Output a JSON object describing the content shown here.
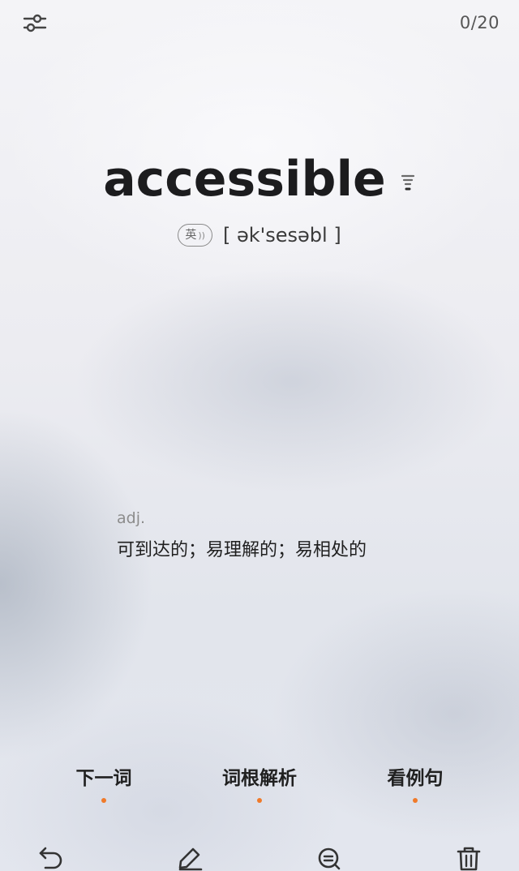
{
  "header": {
    "settings_icon": "sliders-icon",
    "progress": "0/20"
  },
  "word": {
    "headword": "accessible",
    "frequency_icon": "frequency-bars-icon",
    "accent_label": "英",
    "sound_icon": "sound-wave-icon",
    "phonetic": "[ ək'sesəbl ]"
  },
  "definition": {
    "part_of_speech": "adj.",
    "meaning": "可到达的；易理解的；易相处的"
  },
  "actions": {
    "next_word": "下一词",
    "root_analysis": "词根解析",
    "examples": "看例句",
    "dot_color": "#f07a2a"
  },
  "toolbar": {
    "undo_icon": "undo-icon",
    "edit_icon": "pencil-icon",
    "zoom_icon": "zoom-search-icon",
    "delete_icon": "trash-icon"
  }
}
